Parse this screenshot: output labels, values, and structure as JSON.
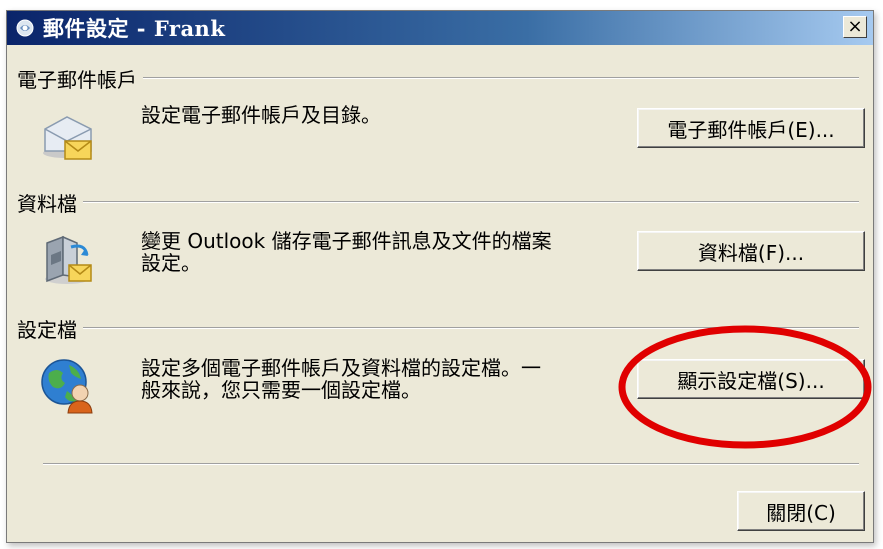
{
  "window": {
    "title": "郵件設定 - Frank",
    "close_label": "×"
  },
  "sections": {
    "email": {
      "header": "電子郵件帳戶",
      "description": "設定電子郵件帳戶及目錄。",
      "button": "電子郵件帳戶(E)...",
      "icon": "envelope-icon"
    },
    "data_files": {
      "header": "資料檔",
      "description_line1": "變更 Outlook 儲存電子郵件訊息及文件的檔案",
      "description_line2": "設定。",
      "button": "資料檔(F)...",
      "icon": "data-file-icon"
    },
    "profiles": {
      "header": "設定檔",
      "description_line1": "設定多個電子郵件帳戶及資料檔的設定檔。一",
      "description_line2": "般來說，您只需要一個設定檔。",
      "button": "顯示設定檔(S)...",
      "icon": "profile-globe-icon"
    }
  },
  "footer": {
    "close_button": "關閉(C)"
  },
  "colors": {
    "title_bar": "#0a246a",
    "window_bg": "#ece9d8",
    "highlight": "#e00000"
  }
}
